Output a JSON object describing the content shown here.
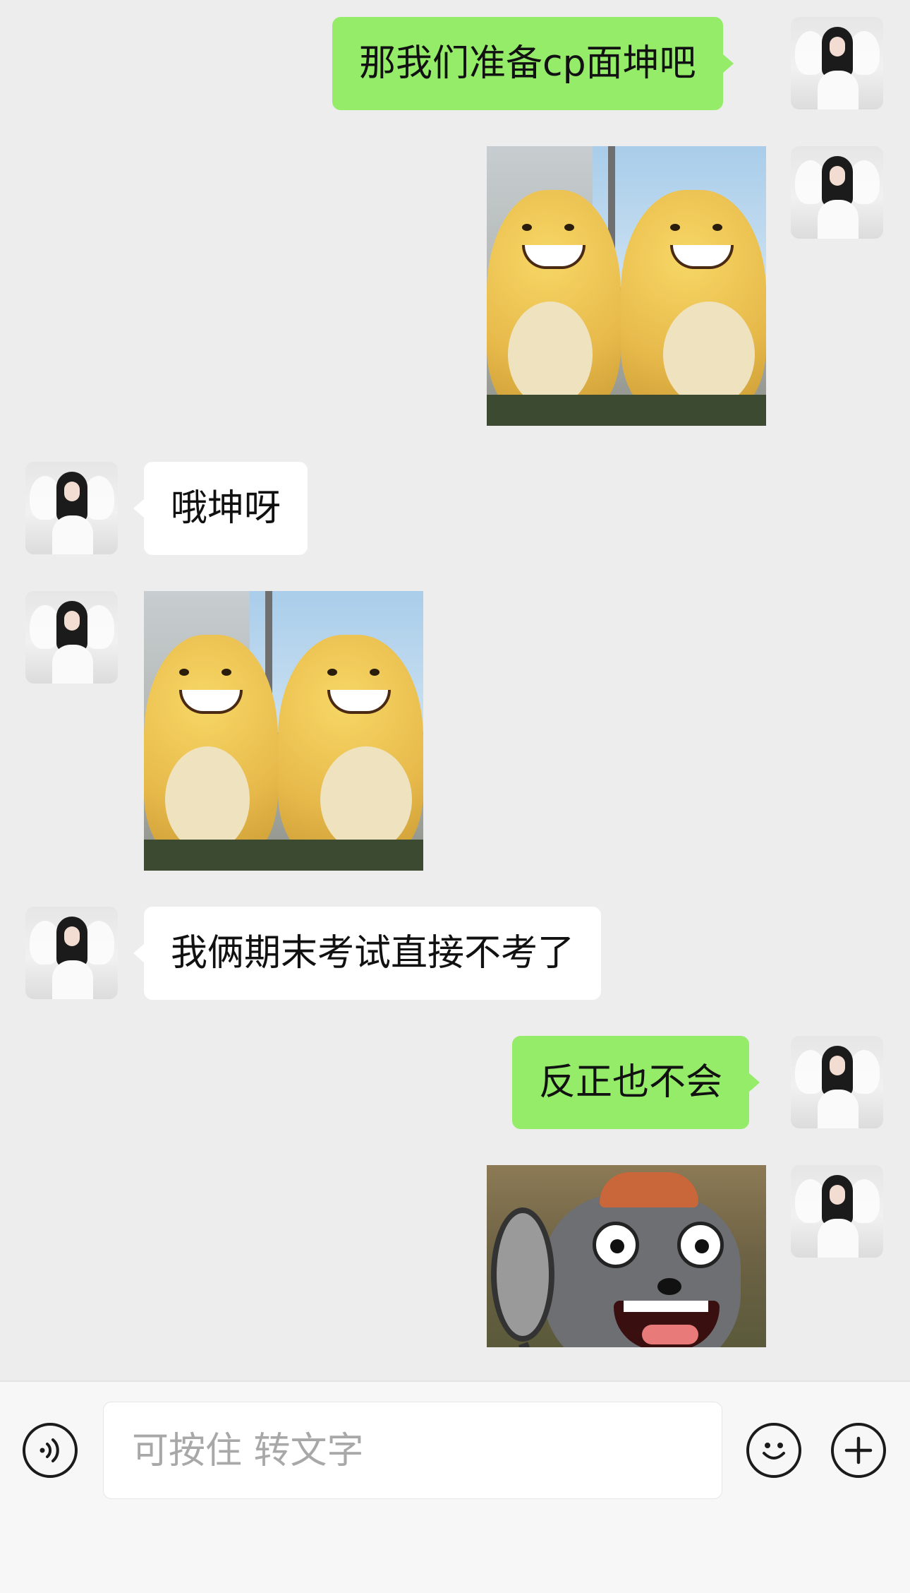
{
  "messages": [
    {
      "side": "right",
      "type": "text",
      "text": "那我们准备cp面坤吧"
    },
    {
      "side": "right",
      "type": "sticker",
      "sticker": "two-yellow-creatures-smiling"
    },
    {
      "side": "left",
      "type": "text",
      "text": "哦坤呀"
    },
    {
      "side": "left",
      "type": "sticker",
      "sticker": "two-yellow-creatures-smiling"
    },
    {
      "side": "left",
      "type": "text",
      "text": "我俩期末考试直接不考了"
    },
    {
      "side": "right",
      "type": "text",
      "text": "反正也不会"
    },
    {
      "side": "right",
      "type": "sticker",
      "sticker": "grey-wolf-with-frying-pan"
    }
  ],
  "input": {
    "placeholder": "可按住 转文字",
    "voice_icon": "voice-icon",
    "emoji_icon": "emoji-icon",
    "plus_icon": "plus-icon"
  },
  "colors": {
    "background": "#ededed",
    "sent_bubble": "#95ec69",
    "received_bubble": "#ffffff"
  }
}
